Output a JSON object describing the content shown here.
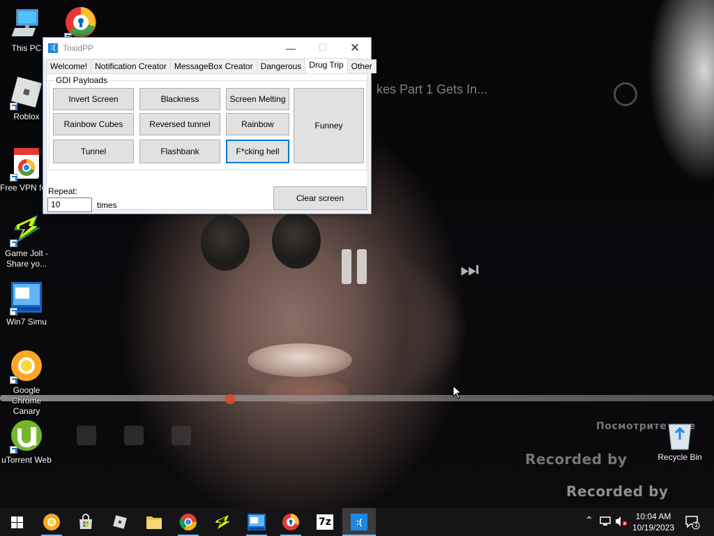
{
  "desktop": {
    "icons": [
      {
        "label": "This PC"
      },
      {
        "label": ""
      },
      {
        "label": "Roblox"
      },
      {
        "label": "Free VPN for Chrome - ..."
      },
      {
        "label": "Game Jolt - Share yo..."
      },
      {
        "label": "Win7 Simu"
      },
      {
        "label": "Google Chrome Canary"
      },
      {
        "label": "uTorrent Web"
      },
      {
        "label": "Recycle Bin"
      }
    ],
    "wallpaper_text": {
      "video_title": "kes Part 1 Gets In...",
      "watermark_1": "Recorded by",
      "watermark_2": "Recorded by",
      "ghost_text": "Посмотрите еще"
    }
  },
  "window": {
    "title": "ToxidPP",
    "tabs": [
      {
        "label": "Welcome!",
        "active": false
      },
      {
        "label": "Notification Creator",
        "active": false
      },
      {
        "label": "MessageBox Creator",
        "active": false
      },
      {
        "label": "Dangerous",
        "active": false
      },
      {
        "label": "Drug Trip",
        "active": true
      },
      {
        "label": "Other",
        "active": false
      }
    ],
    "group_title": "GDI Payloads",
    "payload_buttons": [
      {
        "label": "Invert Screen"
      },
      {
        "label": "Blackness"
      },
      {
        "label": "Screen Melting"
      },
      {
        "label": "Rainbow Cubes"
      },
      {
        "label": "Reversed tunnel"
      },
      {
        "label": "Rainbow"
      },
      {
        "label": "Tunnel"
      },
      {
        "label": "Flashbank"
      },
      {
        "label": "F*cking hell"
      },
      {
        "label": "Funney"
      }
    ],
    "repeat_label": "Repeat:",
    "repeat_value": "10",
    "times_label": "times",
    "clear_button": "Clear screen"
  },
  "taskbar": {
    "apps": [
      "start-windows-icon",
      "chrome-canary-icon",
      "microsoft-store-icon",
      "roblox-icon",
      "file-explorer-icon",
      "google-chrome-icon",
      "game-jolt-icon",
      "win7-simu-icon",
      "vpn-chrome-icon",
      "7zip-icon",
      "toxidpp-icon"
    ],
    "clock_time": "10:04 AM",
    "clock_date": "10/19/2023",
    "notification_count": "1"
  },
  "colors": {
    "accent": "#0078d7",
    "taskbar": "#151518",
    "window_border": "#6b8fc9"
  }
}
